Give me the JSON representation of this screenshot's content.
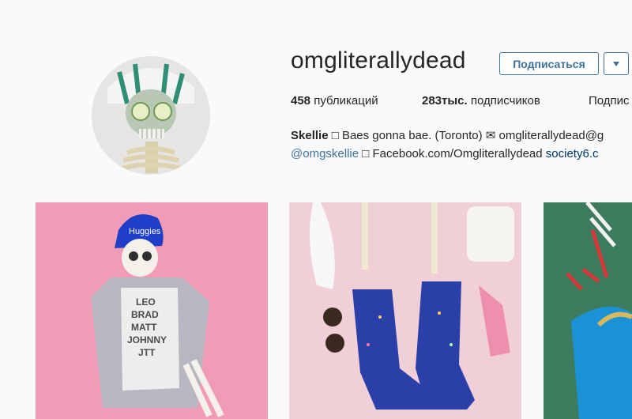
{
  "profile": {
    "username": "omgliterallydead",
    "follow_label": "Подписаться",
    "stats": {
      "posts_count": "458",
      "posts_label": "публикаций",
      "followers_count": "283тыс.",
      "followers_label": "подписчиков",
      "following_label": "Подпис"
    },
    "bio": {
      "name": "Skellie",
      "line1_rest": "Baes gonna bae. (Toronto) ✉ omgliterallydead@g",
      "mention": "@omgskellie",
      "facebook": "Facebook.com/Omgliterallydead",
      "link": "society6.c"
    }
  },
  "icons": {
    "avatar": "skull-avatar",
    "dropdown": "dropdown-triangle-icon",
    "emoji_placeholder": "emoji-icon"
  },
  "photos": {
    "photo1_text": [
      "LEO",
      "BRAD",
      "MATT",
      "JOHNNY",
      "JTT"
    ],
    "photo1_hat_text": "Huggies"
  },
  "colors": {
    "accent": "#3f729b",
    "link": "#003569",
    "background": "#fafafa"
  }
}
